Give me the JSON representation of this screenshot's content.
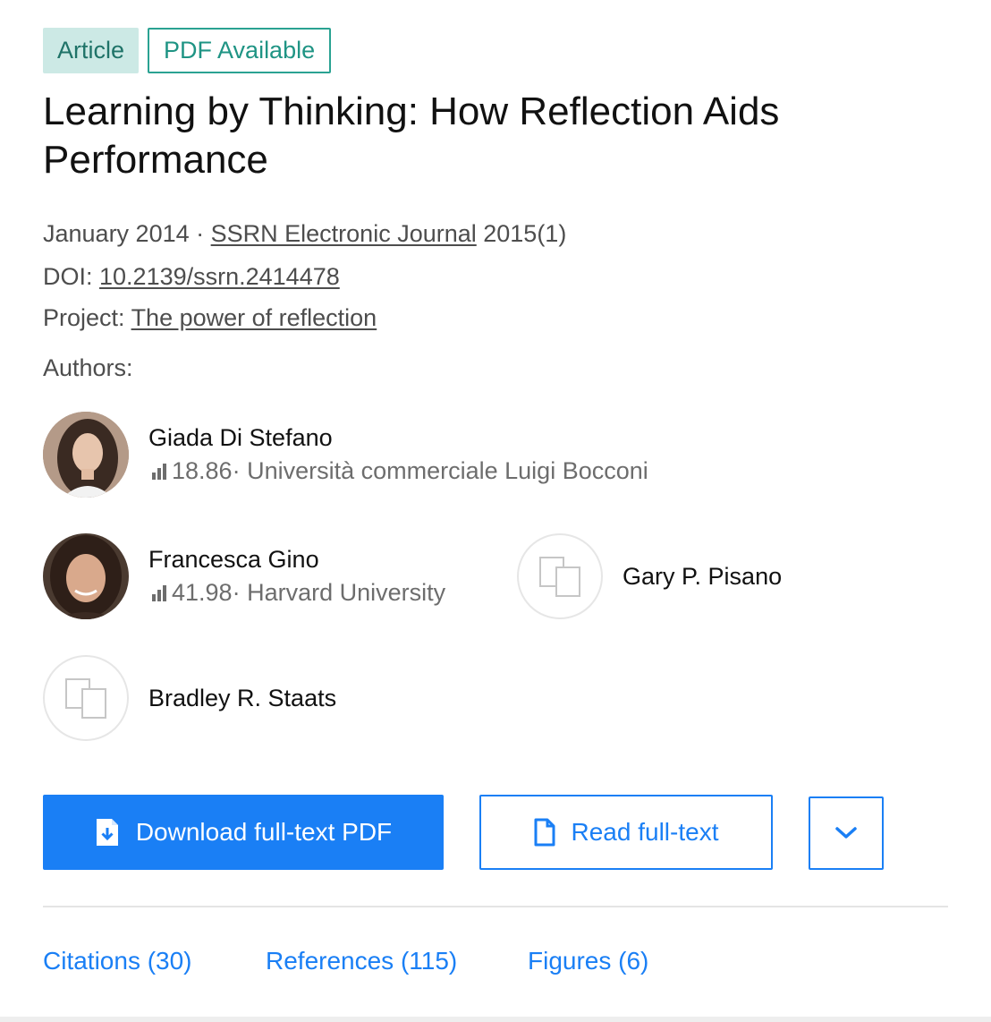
{
  "badges": {
    "article": "Article",
    "pdf": "PDF Available"
  },
  "title": "Learning by Thinking: How Reflection Aids Performance",
  "meta": {
    "date": "January 2014",
    "separator": " · ",
    "journal": "SSRN Electronic Journal",
    "volume": " 2015(1)",
    "doi_label": "DOI: ",
    "doi": "10.2139/ssrn.2414478",
    "project_label": "Project: ",
    "project": "The power of reflection"
  },
  "authors_label": "Authors:",
  "authors": [
    {
      "name": "Giada Di Stefano",
      "score": "18.86",
      "affiliation": " · Università commerciale Luigi Bocconi"
    },
    {
      "name": "Francesca Gino",
      "score": "41.98",
      "affiliation": " · Harvard University"
    },
    {
      "name": "Gary P. Pisano"
    },
    {
      "name": "Bradley R. Staats"
    }
  ],
  "actions": {
    "download": "Download full-text PDF",
    "read": "Read full-text"
  },
  "tabs": [
    "Citations (30)",
    "References (115)",
    "Figures (6)"
  ],
  "colors": {
    "accent": "#1a7ff5",
    "badge_bg": "#cce9e5",
    "badge_text": "#1f7368",
    "pdf_border": "#2aa292"
  }
}
